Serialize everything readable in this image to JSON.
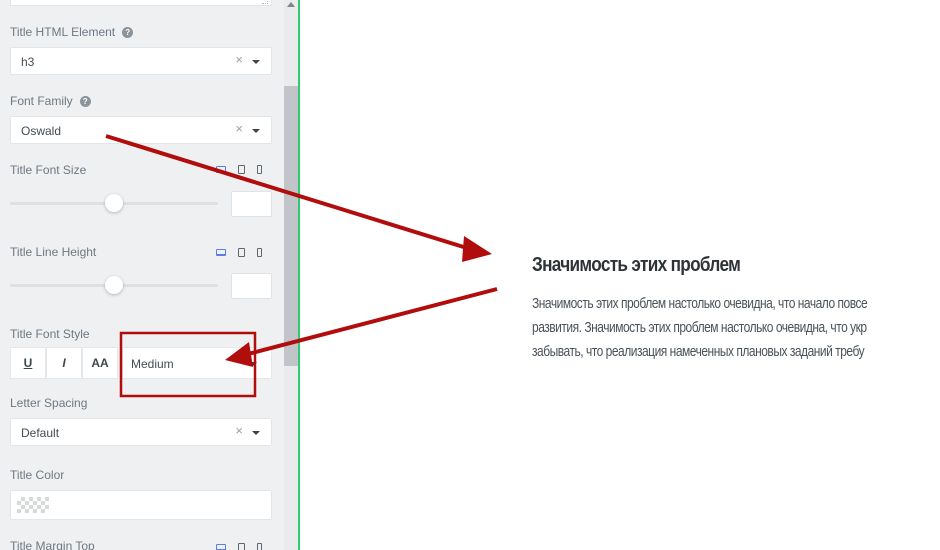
{
  "panel": {
    "title_html_element": {
      "label": "Title HTML Element",
      "value": "h3",
      "clear": "×"
    },
    "font_family": {
      "label": "Font Family",
      "value": "Oswald",
      "clear": "×"
    },
    "title_font_size": {
      "label": "Title Font Size",
      "slider_fraction": 0.5
    },
    "title_line_height": {
      "label": "Title Line Height",
      "slider_fraction": 0.5
    },
    "title_font_style": {
      "label": "Title Font Style",
      "underline": "U",
      "italic": "I",
      "uppercase": "AA",
      "weight": "Medium"
    },
    "letter_spacing": {
      "label": "Letter Spacing",
      "value": "Default",
      "clear": "×"
    },
    "title_color": {
      "label": "Title Color"
    },
    "title_margin_top": {
      "label": "Title Margin Top"
    },
    "help_glyph": "?"
  },
  "preview": {
    "title": "Значимость этих проблем",
    "lines": [
      "Значимость этих проблем настолько очевидна, что начало повсе",
      "развития. Значимость этих проблем настолько очевидна, что укр",
      "забывать, что реализация намеченных плановых заданий требу"
    ]
  },
  "colors": {
    "accent_green": "#2ecc71",
    "annotation_red": "#b10d0d",
    "active_device": "#5b7ee6"
  }
}
